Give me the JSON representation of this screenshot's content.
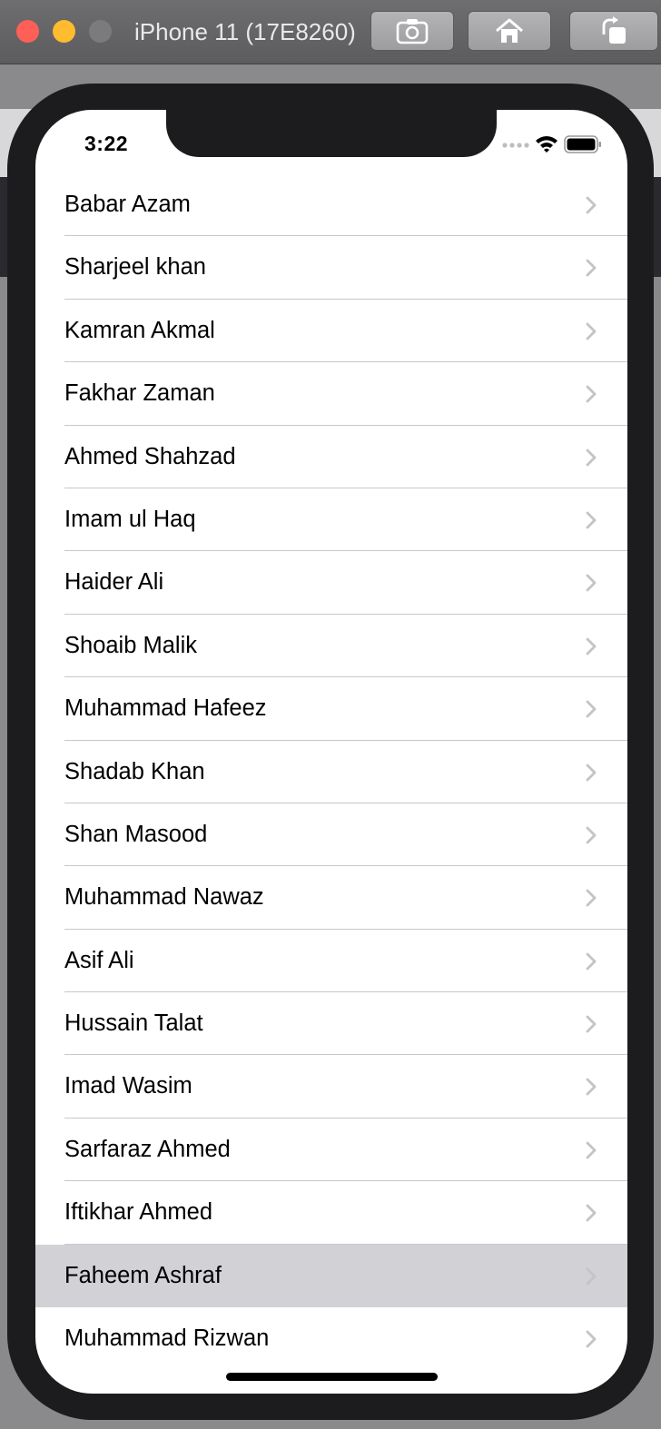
{
  "window": {
    "title": "iPhone 11 (17E8260)",
    "buttons": [
      "screenshot",
      "home",
      "rotate"
    ]
  },
  "status_bar": {
    "time": "3:22"
  },
  "players": [
    {
      "name": "Babar Azam"
    },
    {
      "name": "Sharjeel khan"
    },
    {
      "name": "Kamran Akmal"
    },
    {
      "name": "Fakhar Zaman"
    },
    {
      "name": "Ahmed Shahzad"
    },
    {
      "name": "Imam ul Haq"
    },
    {
      "name": "Haider Ali"
    },
    {
      "name": "Shoaib Malik"
    },
    {
      "name": "Muhammad Hafeez"
    },
    {
      "name": "Shadab Khan"
    },
    {
      "name": "Shan Masood"
    },
    {
      "name": "Muhammad Nawaz"
    },
    {
      "name": "Asif Ali"
    },
    {
      "name": "Hussain Talat"
    },
    {
      "name": "Imad Wasim"
    },
    {
      "name": "Sarfaraz Ahmed"
    },
    {
      "name": "Iftikhar Ahmed"
    },
    {
      "name": "Faheem Ashraf",
      "selected": true
    },
    {
      "name": "Muhammad Rizwan"
    }
  ],
  "colors": {
    "selected_row": "#d1d1d6",
    "separator": "#c8c7cc",
    "chevron": "#c4c4c7"
  }
}
